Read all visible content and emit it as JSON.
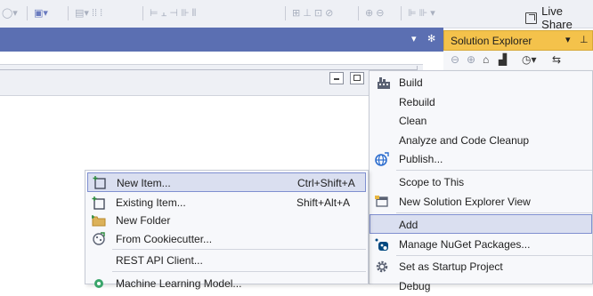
{
  "toolbar": {
    "live_share_label": "Live Share"
  },
  "solution_explorer": {
    "title": "Solution Explorer"
  },
  "right_menu": {
    "items": [
      {
        "label": "Build",
        "icon": "build-icon"
      },
      {
        "label": "Rebuild"
      },
      {
        "label": "Clean"
      },
      {
        "label": "Analyze and Code Cleanup"
      },
      {
        "label": "Publish...",
        "icon": "publish-globe-icon"
      },
      {
        "label": "Scope to This"
      },
      {
        "label": "New Solution Explorer View",
        "icon": "new-view-icon"
      },
      {
        "label": "Add",
        "highlighted": true
      },
      {
        "label": "Manage NuGet Packages...",
        "icon": "nuget-icon"
      },
      {
        "label": "Set as Startup Project",
        "icon": "gear-icon"
      },
      {
        "label": "Debug"
      }
    ]
  },
  "left_menu": {
    "items": [
      {
        "label": "New Item...",
        "shortcut": "Ctrl+Shift+A",
        "icon": "new-item-icon",
        "highlighted": true
      },
      {
        "label": "Existing Item...",
        "shortcut": "Shift+Alt+A",
        "icon": "existing-item-icon"
      },
      {
        "label": "New Folder",
        "icon": "folder-icon"
      },
      {
        "label": "From Cookiecutter...",
        "icon": "cookiecutter-icon"
      },
      {
        "label": "REST API Client..."
      },
      {
        "label": "Machine Learning Model...",
        "icon": "ml-model-icon"
      }
    ]
  },
  "colors": {
    "header_blue": "#5b6fb2",
    "solution_explorer_tab": "#f4c24b",
    "menu_highlight": "#dadff0",
    "menu_highlight_border": "#7f8fd0"
  }
}
